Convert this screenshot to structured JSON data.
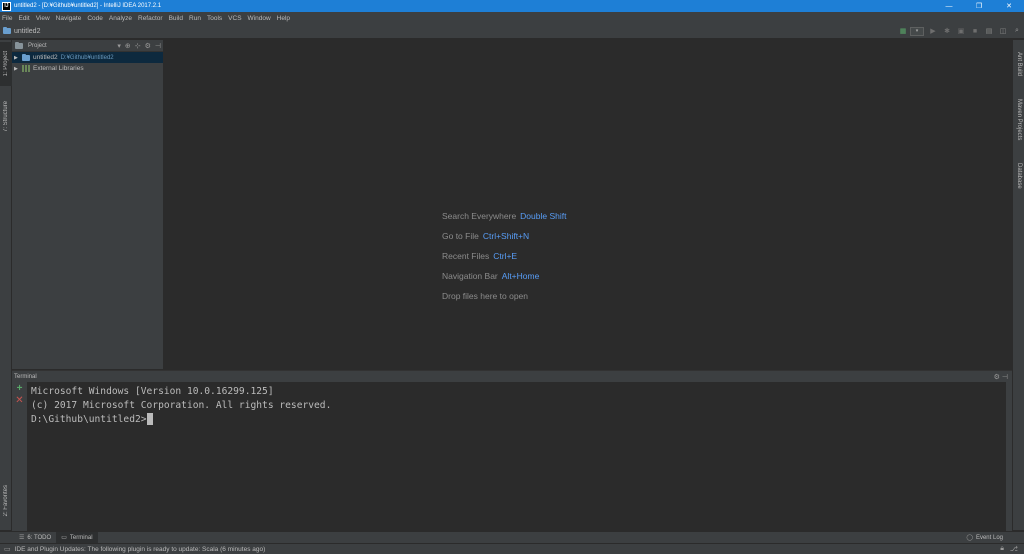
{
  "window": {
    "title": "untitled2 - [D:¥Github¥untitled2] - IntelliJ IDEA 2017.2.1",
    "app_icon_text": "IJ",
    "minimize": "—",
    "maximize": "❐",
    "close": "✕"
  },
  "menu": [
    "File",
    "Edit",
    "View",
    "Navigate",
    "Code",
    "Analyze",
    "Refactor",
    "Build",
    "Run",
    "Tools",
    "VCS",
    "Window",
    "Help"
  ],
  "navbar": {
    "breadcrumb": "untitled2"
  },
  "left_tabs": {
    "project": "1: Project",
    "structure": "7: Structure",
    "favorites": "2: Favorites"
  },
  "right_tabs": {
    "ant_build": "Ant Build",
    "maven": "Maven Projects",
    "database": "Database"
  },
  "project_panel": {
    "title": "Project",
    "tree": [
      {
        "label": "untitled2",
        "path": "D:¥Github¥untitled2"
      },
      {
        "label": "External Libraries",
        "path": ""
      }
    ]
  },
  "editor": {
    "hints": [
      {
        "label": "Search Everywhere",
        "shortcut": "Double Shift"
      },
      {
        "label": "Go to File",
        "shortcut": "Ctrl+Shift+N"
      },
      {
        "label": "Recent Files",
        "shortcut": "Ctrl+E"
      },
      {
        "label": "Navigation Bar",
        "shortcut": "Alt+Home"
      },
      {
        "label": "Drop files here to open",
        "shortcut": ""
      }
    ]
  },
  "terminal": {
    "title": "Terminal",
    "lines": [
      "Microsoft Windows [Version 10.0.16299.125]",
      "(c) 2017 Microsoft Corporation. All rights reserved.",
      "",
      "D:\\Github\\untitled2>"
    ]
  },
  "bottom_tabs": {
    "todo": "6: TODO",
    "terminal": "Terminal",
    "event_log": "Event Log"
  },
  "status": {
    "message": "IDE and Plugin Updates: The following plugin is ready to update: Scala (6 minutes ago)"
  },
  "colors": {
    "title_bar": "#1e7fd6",
    "panel_bg": "#3c3f41",
    "editor_bg": "#2b2b2b",
    "shortcut": "#589df6",
    "selection": "#0d293e",
    "add_green": "#59a869",
    "close_red": "#c75450"
  }
}
